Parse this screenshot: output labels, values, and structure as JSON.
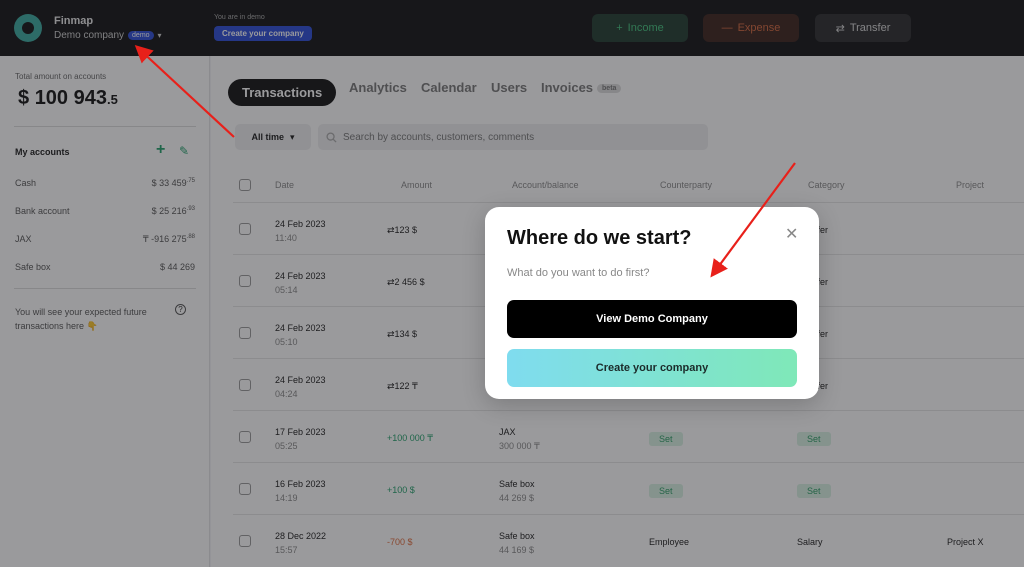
{
  "header": {
    "brand": "Finmap",
    "company": "Demo company",
    "demo_badge": "demo",
    "you_are_in_demo": "You are in demo",
    "create_company": "Create your company",
    "income": "Income",
    "expense": "Expense",
    "transfer": "Transfer"
  },
  "sidebar": {
    "total_label": "Total amount on accounts",
    "total_currency": "$",
    "total_int": "100 943",
    "total_dec": ".5",
    "my_accounts": "My accounts",
    "accounts": [
      {
        "name": "Cash",
        "balance": "$ 33 459",
        "dec": ".75"
      },
      {
        "name": "Bank account",
        "balance": "$ 25 216",
        "dec": ".93"
      },
      {
        "name": "JAX",
        "balance": "₸ -916 275",
        "dec": ".88"
      },
      {
        "name": "Safe box",
        "balance": "$ 44 269",
        "dec": ""
      }
    ],
    "future_note": "You will see your expected future transactions here 👇"
  },
  "main": {
    "tabs": [
      "Transactions",
      "Analytics",
      "Calendar",
      "Users",
      "Invoices"
    ],
    "beta": "beta",
    "filter": "All time",
    "search_placeholder": "Search by accounts, customers, comments",
    "columns": [
      "Date",
      "Amount",
      "Account/balance",
      "Counterparty",
      "Category",
      "Project"
    ],
    "rows": [
      {
        "date": "24 Feb 2023",
        "time": "11:40",
        "amount": "⇄123 $",
        "account": "",
        "balance": "",
        "counterparty": "",
        "category": "sfer",
        "project": ""
      },
      {
        "date": "24 Feb 2023",
        "time": "05:14",
        "amount": "⇄2 456 $",
        "account": "",
        "balance": "",
        "counterparty": "",
        "category": "sfer",
        "project": ""
      },
      {
        "date": "24 Feb 2023",
        "time": "05:10",
        "amount": "⇄134 $",
        "account": "",
        "balance": "",
        "counterparty": "",
        "category": "sfer",
        "project": ""
      },
      {
        "date": "24 Feb 2023",
        "time": "04:24",
        "amount": "⇄122 ₸",
        "account": "",
        "balance": "",
        "counterparty": "",
        "category": "sfer",
        "project": ""
      },
      {
        "date": "17 Feb 2023",
        "time": "05:25",
        "amount": "+100 000 ₸",
        "account": "JAX",
        "balance": "300 000 ₸",
        "counterparty": "Set",
        "category": "Set",
        "project": ""
      },
      {
        "date": "16 Feb 2023",
        "time": "14:19",
        "amount": "+100 $",
        "account": "Safe box",
        "balance": "44 269 $",
        "counterparty": "Set",
        "category": "Set",
        "project": ""
      },
      {
        "date": "28 Dec 2022",
        "time": "15:57",
        "amount": "-700 $",
        "account": "Safe box",
        "balance": "44 169 $",
        "counterparty": "Employee",
        "category": "Salary",
        "project": "Project X"
      }
    ]
  },
  "modal": {
    "title": "Where do we start?",
    "subtitle": "What do you want to do first?",
    "view_demo": "View Demo Company",
    "create": "Create your company"
  },
  "colors": {
    "accent_green": "#22a06b",
    "expense_orange": "#e06a3a",
    "demo_blue": "#2a4bd8",
    "annotation_red": "#e8201a"
  }
}
